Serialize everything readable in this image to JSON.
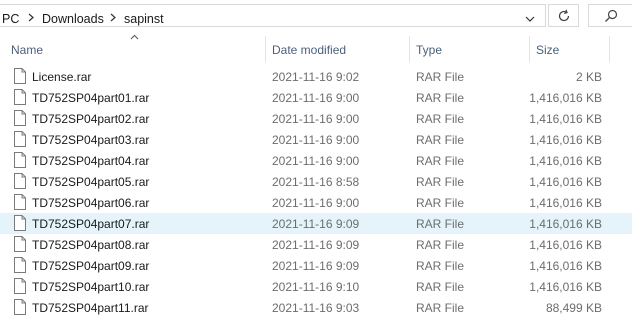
{
  "address": {
    "crumbs": [
      "PC",
      "Downloads",
      "sapinst"
    ],
    "dropdown_icon": "chevron-down-icon",
    "refresh_icon": "refresh-icon",
    "search_icon": "search-icon"
  },
  "columns": {
    "name": "Name",
    "date": "Date modified",
    "type": "Type",
    "size": "Size",
    "sort_icon": "sort-ascending-caret-icon"
  },
  "files": [
    {
      "name": "License.rar",
      "date": "2021-11-16 9:02",
      "type": "RAR File",
      "size": "2 KB",
      "selected": false
    },
    {
      "name": "TD752SP04part01.rar",
      "date": "2021-11-16 9:00",
      "type": "RAR File",
      "size": "1,416,016 KB",
      "selected": false
    },
    {
      "name": "TD752SP04part02.rar",
      "date": "2021-11-16 9:00",
      "type": "RAR File",
      "size": "1,416,016 KB",
      "selected": false
    },
    {
      "name": "TD752SP04part03.rar",
      "date": "2021-11-16 9:00",
      "type": "RAR File",
      "size": "1,416,016 KB",
      "selected": false
    },
    {
      "name": "TD752SP04part04.rar",
      "date": "2021-11-16 9:00",
      "type": "RAR File",
      "size": "1,416,016 KB",
      "selected": false
    },
    {
      "name": "TD752SP04part05.rar",
      "date": "2021-11-16 8:58",
      "type": "RAR File",
      "size": "1,416,016 KB",
      "selected": false
    },
    {
      "name": "TD752SP04part06.rar",
      "date": "2021-11-16 9:00",
      "type": "RAR File",
      "size": "1,416,016 KB",
      "selected": false
    },
    {
      "name": "TD752SP04part07.rar",
      "date": "2021-11-16 9:09",
      "type": "RAR File",
      "size": "1,416,016 KB",
      "selected": true
    },
    {
      "name": "TD752SP04part08.rar",
      "date": "2021-11-16 9:09",
      "type": "RAR File",
      "size": "1,416,016 KB",
      "selected": false
    },
    {
      "name": "TD752SP04part09.rar",
      "date": "2021-11-16 9:09",
      "type": "RAR File",
      "size": "1,416,016 KB",
      "selected": false
    },
    {
      "name": "TD752SP04part10.rar",
      "date": "2021-11-16 9:10",
      "type": "RAR File",
      "size": "1,416,016 KB",
      "selected": false
    },
    {
      "name": "TD752SP04part11.rar",
      "date": "2021-11-16 9:03",
      "type": "RAR File",
      "size": "88,499 KB",
      "selected": false
    }
  ],
  "colors": {
    "header_text": "#4c607a",
    "selected_row": "#e5f3fb",
    "muted_text": "#6d6d6d"
  }
}
